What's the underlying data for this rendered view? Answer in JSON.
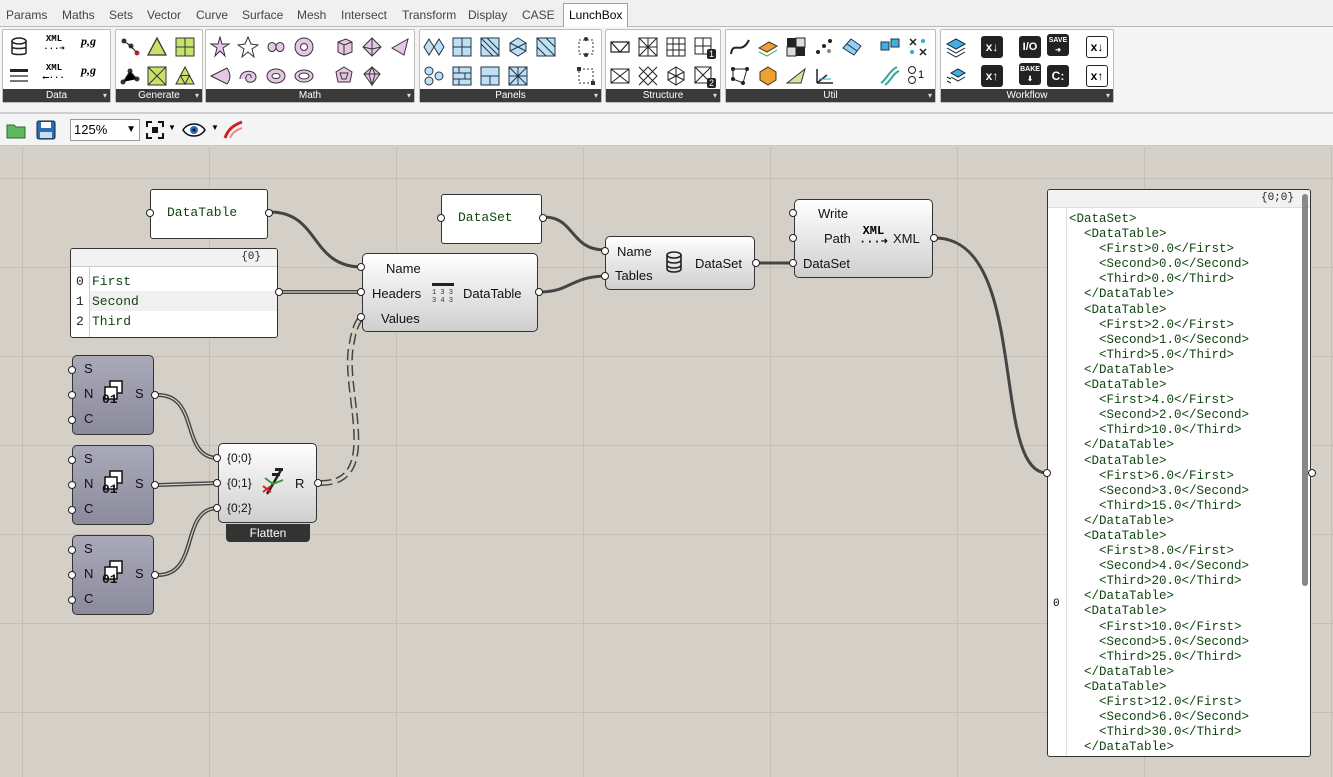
{
  "tabs": [
    "Params",
    "Maths",
    "Sets",
    "Vector",
    "Curve",
    "Surface",
    "Mesh",
    "Intersect",
    "Transform",
    "Display",
    "CASE",
    "LunchBox"
  ],
  "ribbon_groups": [
    "Data",
    "Generate",
    "Math",
    "Panels",
    "Structure",
    "Util",
    "Workflow"
  ],
  "ribbon_icon_text": {
    "xml": "XML",
    "pg": "p,g",
    "io": "I/O",
    "save": "SAVE",
    "bake": "BAKE",
    "c": "C:",
    "x": "x",
    "one": "1",
    "two": "2"
  },
  "zoom": "125%",
  "canvas": {
    "panel_datatable": "DataTable",
    "panel_dataset": "DataSet",
    "headers_panel": {
      "path": "{0}",
      "rows": [
        {
          "index": "0",
          "text": "First"
        },
        {
          "index": "1",
          "text": "Second"
        },
        {
          "index": "2",
          "text": "Third"
        }
      ]
    },
    "datatable_comp": {
      "inputs": [
        "Name",
        "Headers",
        "Values"
      ],
      "output": "DataTable"
    },
    "dataset_comp": {
      "inputs": [
        "Name",
        "Tables"
      ],
      "output": "DataSet"
    },
    "xml_comp": {
      "inputs": [
        "Write",
        "Path",
        "DataSet"
      ],
      "output": "XML",
      "icon": "XML"
    },
    "series": {
      "inputs": [
        "S",
        "N",
        "C"
      ],
      "output": "S"
    },
    "flatten": {
      "inputs": [
        "{0;0}",
        "{0;1}",
        "{0;2}"
      ],
      "output": "R",
      "label": "Flatten"
    },
    "output_panel": {
      "path": "{0;0}",
      "index": "0",
      "lines": [
        "<DataSet>",
        "  <DataTable>",
        "    <First>0.0</First>",
        "    <Second>0.0</Second>",
        "    <Third>0.0</Third>",
        "  </DataTable>",
        "  <DataTable>",
        "    <First>2.0</First>",
        "    <Second>1.0</Second>",
        "    <Third>5.0</Third>",
        "  </DataTable>",
        "  <DataTable>",
        "    <First>4.0</First>",
        "    <Second>2.0</Second>",
        "    <Third>10.0</Third>",
        "  </DataTable>",
        "  <DataTable>",
        "    <First>6.0</First>",
        "    <Second>3.0</Second>",
        "    <Third>15.0</Third>",
        "  </DataTable>",
        "  <DataTable>",
        "    <First>8.0</First>",
        "    <Second>4.0</Second>",
        "    <Third>20.0</Third>",
        "  </DataTable>",
        "  <DataTable>",
        "    <First>10.0</First>",
        "    <Second>5.0</Second>",
        "    <Third>25.0</Third>",
        "  </DataTable>",
        "  <DataTable>",
        "    <First>12.0</First>",
        "    <Second>6.0</Second>",
        "    <Third>30.0</Third>",
        "  </DataTable>"
      ]
    }
  }
}
